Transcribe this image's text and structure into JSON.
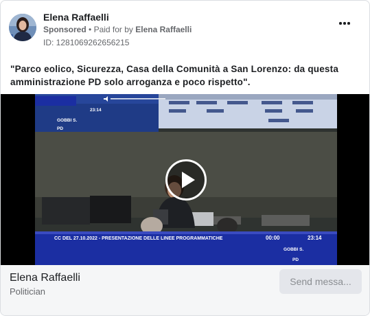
{
  "advertiser": {
    "name": "Elena Raffaelli",
    "sponsored_label": "Sponsored",
    "paid_for_prefix": "Paid for by",
    "paid_for_name": "Elena Raffaelli",
    "library_id": "ID: 1281069262656215",
    "category": "Politician"
  },
  "ad": {
    "body": "\"Parco eolico, Sicurezza, Casa della Comunità a San Lorenzo: da questa amministrazione PD solo arroganza e poco rispetto\"."
  },
  "video": {
    "icon": "play-icon",
    "overlay_title": "CC DEL 27.10.2022 - PRESENTAZIONE DELLE LINEE PROGRAMMATICHE",
    "timer_elapsed": "00:00",
    "timer_clock": "23:14",
    "speaker_name": "GOBBI S.",
    "speaker_party": "PD",
    "top_speaker_name": "GOBBI S.",
    "top_speaker_party": "PD",
    "top_timer": "23:14"
  },
  "cta": {
    "label": "Send messa..."
  },
  "colors": {
    "accent_text": "#1c1e21",
    "muted": "#65676b",
    "footer_bg": "#f5f6f7",
    "button_bg": "#e4e6eb"
  }
}
